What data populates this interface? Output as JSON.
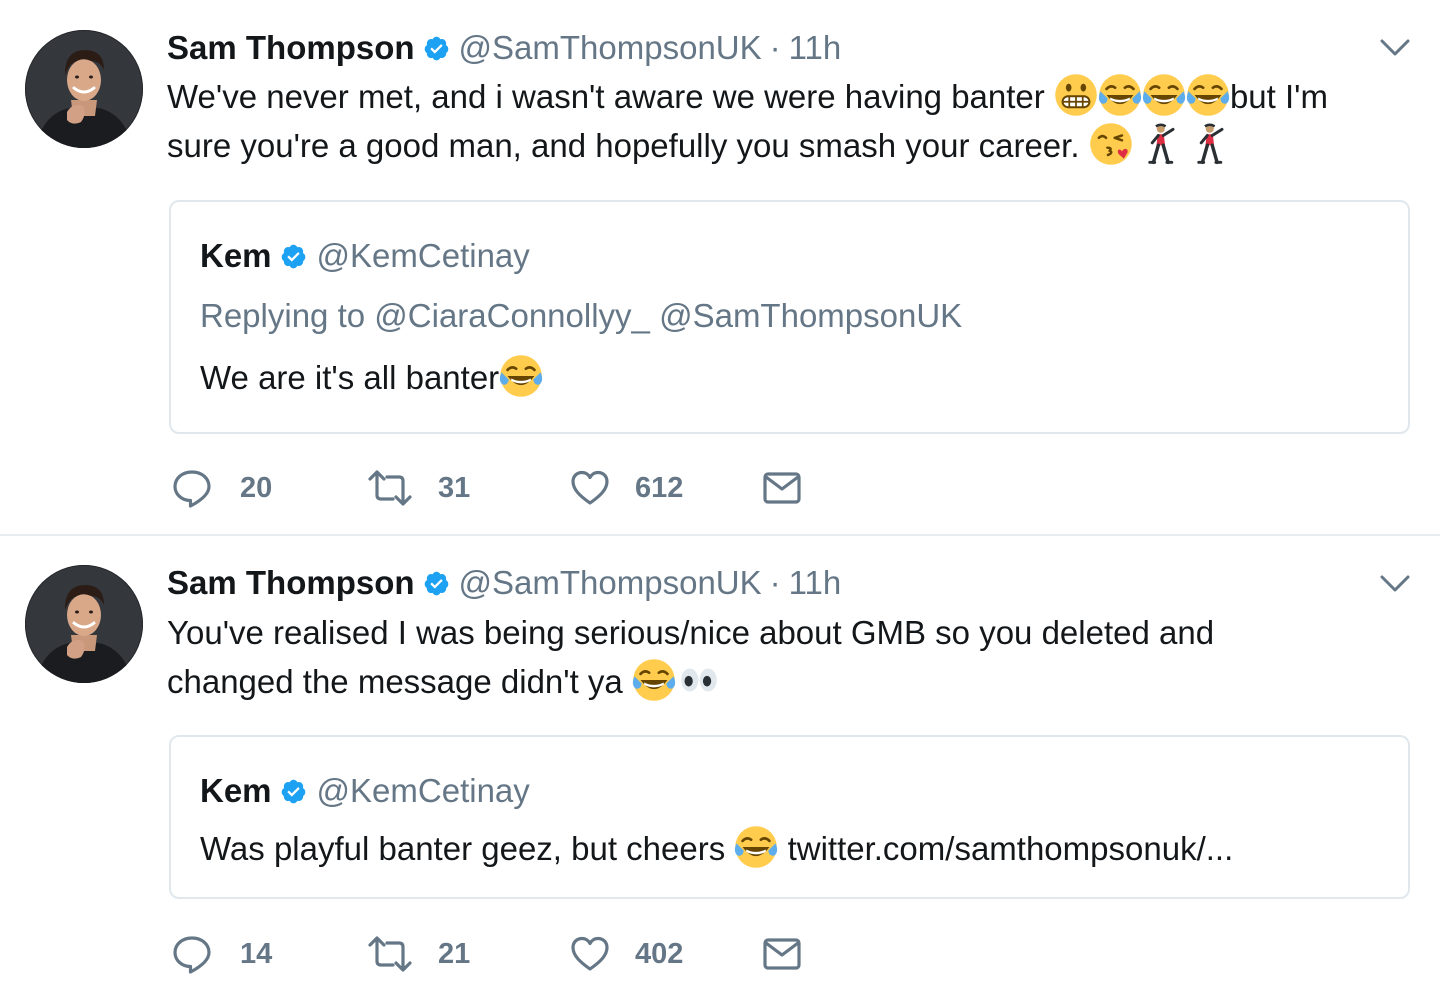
{
  "tweets": [
    {
      "author": {
        "name": "Sam Thompson",
        "handle": "@SamThompsonUK",
        "verified": true
      },
      "time": "11h",
      "separator": "·",
      "text_lines": [
        [
          "We've never met, and i wasn't aware we were having banter ",
          "grimacing-face",
          "face-with-tears-of-joy",
          "face-with-tears-of-joy",
          "face-with-tears-of-joy",
          "but I'm"
        ],
        [
          "sure you're a good man, and hopefully you smash your career. ",
          "face-blowing-a-kiss",
          "man-dancing",
          "man-dancing"
        ]
      ],
      "text": {
        "line1": "We've never met, and i wasn't aware we were having banter ",
        "line1_end": "but I'm",
        "line2": "sure you're a good man, and hopefully you smash your career. "
      },
      "quote": {
        "author_name": "Kem",
        "author_handle": "@KemCetinay",
        "verified": true,
        "replying_to_label": "Replying to",
        "replying_to": [
          "@CiaraConnollyy_",
          "@SamThompsonUK"
        ],
        "text": "We are it's all banter",
        "text_emoji": "face-with-tears-of-joy"
      },
      "actions": {
        "replies": "20",
        "retweets": "31",
        "likes": "612"
      }
    },
    {
      "author": {
        "name": "Sam Thompson",
        "handle": "@SamThompsonUK",
        "verified": true
      },
      "time": "11h",
      "separator": "·",
      "text": {
        "line1": "You've realised I was being serious/nice about GMB so you deleted and",
        "line2": "changed the message didn't ya "
      },
      "text_emojis": [
        "face-with-tears-of-joy",
        "eyes"
      ],
      "quote": {
        "author_name": "Kem",
        "author_handle": "@KemCetinay",
        "verified": true,
        "text": "Was playful banter geez, but cheers ",
        "text_emoji": "face-with-tears-of-joy",
        "link": "twitter.com/samthompsonuk/..."
      },
      "actions": {
        "replies": "14",
        "retweets": "21",
        "likes": "402"
      }
    }
  ],
  "colors": {
    "text": "#14171a",
    "secondary": "#657786",
    "verified": "#1da1f2",
    "border": "#e1e8ed",
    "emoji_yellow": "#ffcc4d",
    "tear_blue": "#5dadec"
  },
  "icons": {
    "reply": "reply-icon",
    "retweet": "retweet-icon",
    "like": "heart-icon",
    "dm": "envelope-icon",
    "more": "chevron-down-icon",
    "verified": "verified-badge-icon"
  }
}
